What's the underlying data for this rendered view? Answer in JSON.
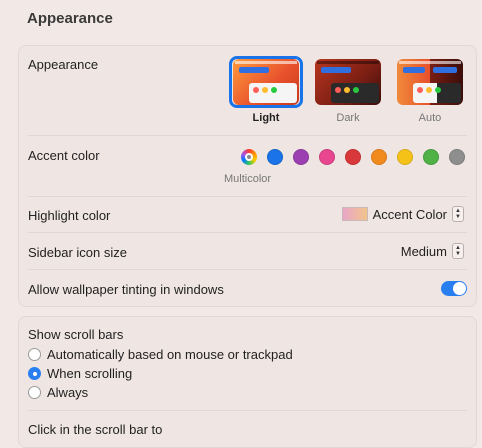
{
  "page_title": "Appearance",
  "appearance": {
    "label": "Appearance",
    "options": [
      {
        "label": "Light",
        "selected": true
      },
      {
        "label": "Dark",
        "selected": false
      },
      {
        "label": "Auto",
        "selected": false
      }
    ]
  },
  "accent": {
    "label": "Accent color",
    "multicolor_label": "Multicolor",
    "colors": [
      "multicolor",
      "#1a73e8",
      "#9b3fb1",
      "#e8478f",
      "#d9383a",
      "#f28b1e",
      "#f5c218",
      "#4fb146",
      "#8e8e8e"
    ]
  },
  "highlight": {
    "label": "Highlight color",
    "value": "Accent Color"
  },
  "sidebar_icon": {
    "label": "Sidebar icon size",
    "value": "Medium"
  },
  "tinting": {
    "label": "Allow wallpaper tinting in windows",
    "enabled": true
  },
  "scroll_bars": {
    "label": "Show scroll bars",
    "options": [
      {
        "label": "Automatically based on mouse or trackpad",
        "selected": false
      },
      {
        "label": "When scrolling",
        "selected": true
      },
      {
        "label": "Always",
        "selected": false
      }
    ]
  },
  "click_scroll": {
    "label": "Click in the scroll bar to"
  },
  "colors": {
    "accent_blue": "#2a7ff0",
    "background": "#f2e9e6"
  }
}
